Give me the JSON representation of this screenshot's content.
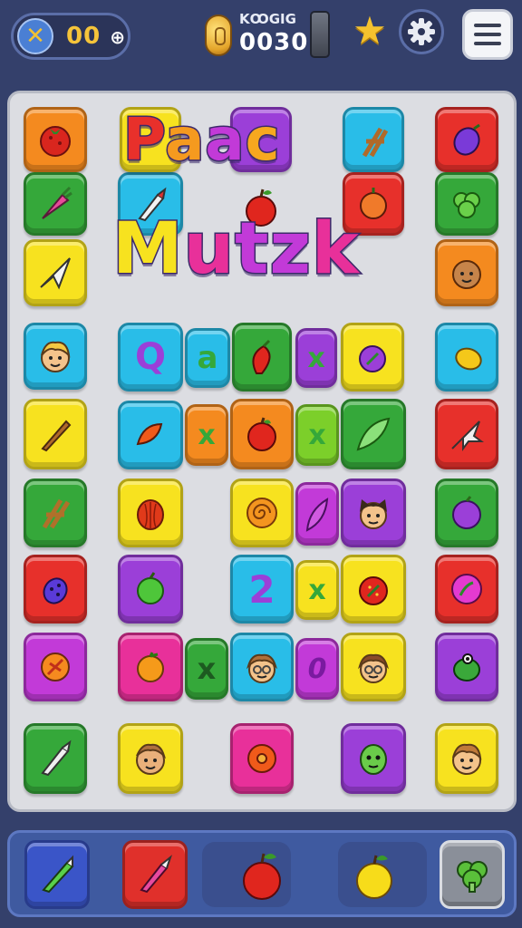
{
  "hud": {
    "left_counter_icon": "x-badge-icon",
    "left_counter_value": "00",
    "left_counter_suffix": "⊕",
    "score_label": "KꝎGIG",
    "score_value": "0030",
    "icons": [
      "coin-icon",
      "battery-icon",
      "star-icon",
      "gear-icon",
      "menu-icon"
    ]
  },
  "title": {
    "line1": [
      "P",
      "a",
      "a",
      "c"
    ],
    "line2": [
      "M",
      "u",
      "t",
      "z",
      "k"
    ],
    "line1_colors": [
      "#e8302b",
      "#f59a1f",
      "#c23ad8",
      "#f7a81f"
    ],
    "line2_colors": [
      "#f7e21f",
      "#e8309a",
      "#c23ad8",
      "#c23ad8",
      "#e8309a"
    ]
  },
  "letter_tiles": [
    {
      "text": "Q",
      "color": "#9b3fd8"
    },
    {
      "text": "a",
      "color": "#35a83a"
    },
    {
      "text": "x",
      "color": "#35a83a"
    },
    {
      "text": "x",
      "color": "#35a83a"
    },
    {
      "text": "x",
      "color": "#35a83a"
    },
    {
      "text": "2",
      "color": "#9b3fd8"
    },
    {
      "text": "x",
      "color": "#35a83a"
    },
    {
      "text": "x",
      "color": "#1d5a20"
    },
    {
      "text": "0",
      "color": "#9b3fd8"
    }
  ],
  "board_icons": [
    "tomato-icon",
    "banana-icon",
    "rocket-icon",
    "apple-icon",
    "hammer-icon",
    "eggplant-icon",
    "carrot-icon",
    "onion-icon",
    "broccoli-icon",
    "paper-plane-icon",
    "face-icon",
    "face-icon",
    "chili-icon",
    "lemon-icon",
    "pencil-icon",
    "pepper-icon",
    "apple-icon",
    "leaf-icon",
    "airplane-icon",
    "slingshot-icon",
    "shell-icon",
    "spiral-icon",
    "feather-icon",
    "face-icon",
    "plum-icon",
    "grapes-icon",
    "lime-icon",
    "strawberry-icon",
    "flower-icon",
    "ball-icon",
    "orange-icon",
    "face-icon",
    "face-icon",
    "leaf-icon",
    "rocket-icon",
    "face-icon",
    "donut-icon",
    "alien-face-icon",
    "face-icon"
  ],
  "tray": {
    "items": [
      "pen-icon",
      "cutter-icon",
      "apple-icon",
      "lemon-icon",
      "broccoli-icon"
    ]
  }
}
